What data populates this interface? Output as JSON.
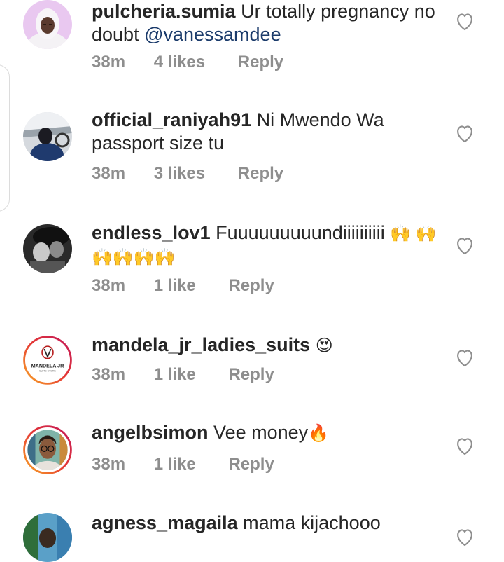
{
  "comments": [
    {
      "username": "pulcheria.sumia",
      "text": "Ur totally pregnancy no doubt ",
      "mention": "@vanessamdee",
      "emoji": "",
      "time": "38m",
      "likes": "4 likes",
      "reply": "Reply",
      "avatar_icon": "hijab-profile-photo"
    },
    {
      "username": "official_raniyah91",
      "text": "Ni Mwendo Wa passport size tu",
      "mention": "",
      "emoji": "",
      "time": "38m",
      "likes": "3 likes",
      "reply": "Reply",
      "avatar_icon": "car-selfie-photo"
    },
    {
      "username": "endless_lov1",
      "text": "Fuuuuuuuuundiiiiiiiiii ",
      "mention": "",
      "emoji": "🙌 🙌🙌🙌🙌🙌",
      "time": "38m",
      "likes": "1 like",
      "reply": "Reply",
      "avatar_icon": "bw-portrait-photo"
    },
    {
      "username": "mandela_jr_ladies_suits",
      "text": "",
      "mention": "",
      "emoji": "😍",
      "time": "38m",
      "likes": "1 like",
      "reply": "Reply",
      "avatar_icon": "mandela-jr-logo",
      "avatar_logo_text": "MANDELA JR",
      "avatar_logo_subtext": "SUITS STORE"
    },
    {
      "username": "angelbsimon",
      "text": "Vee money",
      "mention": "",
      "emoji": "🔥",
      "time": "38m",
      "likes": "1 like",
      "reply": "Reply",
      "avatar_icon": "glasses-portrait-photo"
    },
    {
      "username": "agness_magaila",
      "text": "mama kijachooo",
      "mention": "",
      "emoji": "",
      "time": "",
      "likes": "",
      "reply": "",
      "avatar_icon": "colorful-portrait-photo"
    }
  ],
  "colors": {
    "text": "#262626",
    "meta": "#8e8e8e",
    "mention": "#1b3b6b",
    "story_ring_start": "#f9a825",
    "story_ring_end": "#c2185b"
  }
}
